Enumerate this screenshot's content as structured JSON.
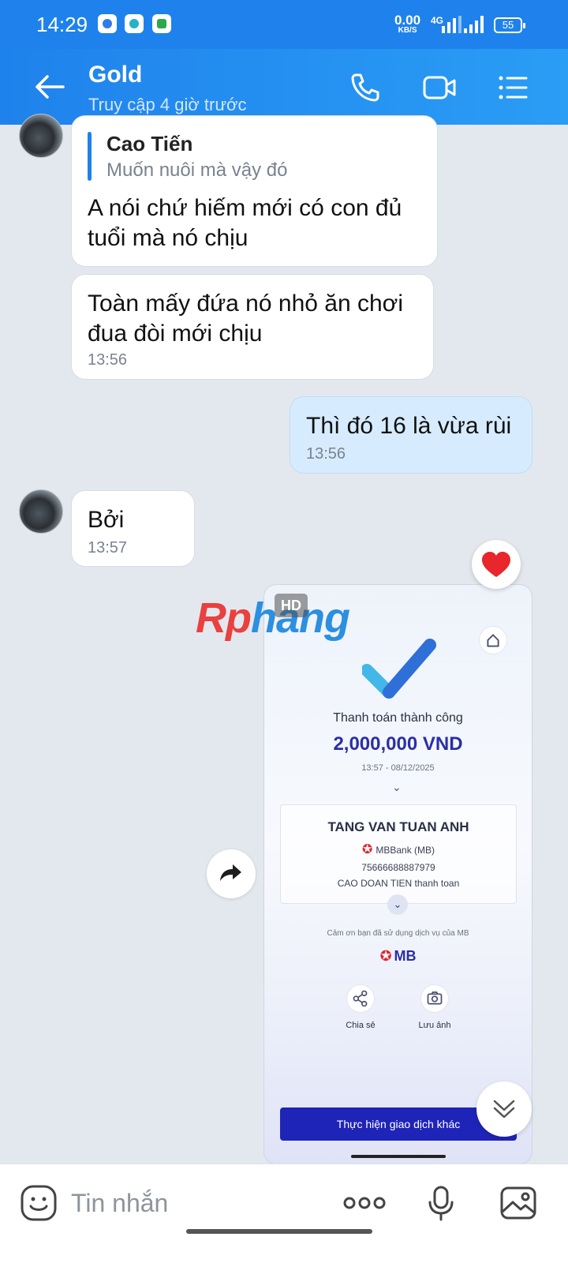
{
  "status_bar": {
    "time": "14:29",
    "net_speed": "0.00",
    "net_unit": "KB/S",
    "network": "4G",
    "battery": "55"
  },
  "header": {
    "contact_name": "Gold",
    "contact_status": "Truy cập 4 giờ trước",
    "accent_color": "#1f82ec"
  },
  "messages": [
    {
      "sender": "them",
      "quote_author": "Cao Tiến",
      "quote_text": "Muốn nuôi mà vậy đó",
      "text": "A nói chứ hiếm mới có con đủ tuổi mà nó chịu"
    },
    {
      "sender": "them",
      "text": "Toàn mấy đứa nó nhỏ ăn chơi đua đòi mới chịu",
      "time": "13:56"
    },
    {
      "sender": "me",
      "text": "Thì đó 16 là vừa rùi",
      "time": "13:56"
    },
    {
      "sender": "them",
      "text": "Bởi",
      "time": "13:57"
    }
  ],
  "image_message": {
    "hd_badge": "HD",
    "watermark_part1": "Rp",
    "watermark_part2": "hang",
    "reaction": "heart",
    "receipt": {
      "title": "Thanh toán thành công",
      "amount": "2,000,000 VND",
      "datetime": "13:57 - 08/12/2025",
      "receiver_name": "TANG VAN TUAN ANH",
      "bank": "MBBank (MB)",
      "account": "75666688887979",
      "note": "CAO DOAN TIEN thanh toan",
      "thanks": "Cảm ơn bạn đã sử dụng dịch vụ của MB",
      "logo": "MB",
      "share_label": "Chia sẻ",
      "save_label": "Lưu ảnh",
      "other_tx_label": "Thực hiện giao dịch khác"
    }
  },
  "input_bar": {
    "placeholder": "Tin nhắn"
  }
}
